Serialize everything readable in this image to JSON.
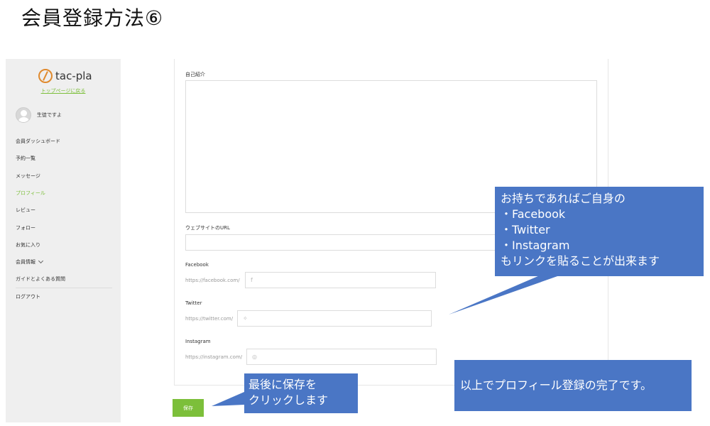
{
  "slide": {
    "title": "会員登録方法⑥"
  },
  "sidebar": {
    "logo_text": "tac-pla",
    "top_link": "トップページに戻る",
    "user_name": "生徒ですよ",
    "items": [
      {
        "label": "会員ダッシュボード"
      },
      {
        "label": "予約一覧"
      },
      {
        "label": "メッセージ"
      },
      {
        "label": "プロフィール"
      },
      {
        "label": "レビュー"
      },
      {
        "label": "フォロー"
      },
      {
        "label": "お気に入り"
      },
      {
        "label": "会員情報"
      },
      {
        "label": "ガイドとよくある質問"
      },
      {
        "label": "ログアウト"
      }
    ],
    "active_item": "プロフィール"
  },
  "form": {
    "bio_label": "自己紹介",
    "bio_value": "",
    "website_label": "ウェブサイトのURL",
    "website_value": "",
    "facebook": {
      "label": "Facebook",
      "prefix": "https://facebook.com/",
      "value": ""
    },
    "twitter": {
      "label": "Twitter",
      "prefix": "https://twitter.com/",
      "value": ""
    },
    "instagram": {
      "label": "Instagram",
      "prefix": "https://instagram.com/",
      "value": ""
    },
    "save_label": "保存"
  },
  "callouts": {
    "social": {
      "line1": "お持ちであればご自身の",
      "line2": "・Facebook",
      "line3": "・Twitter",
      "line4": "・Instagram",
      "line5": "もリンクを貼ることが出来ます"
    },
    "save": {
      "line1": "最後に保存を",
      "line2": "クリックします"
    },
    "done": {
      "text": "以上でプロフィール登録の完了です。"
    }
  },
  "colors": {
    "accent": "#7cbf3a",
    "callout": "#4a76c5",
    "logo": "#e08a2e"
  }
}
